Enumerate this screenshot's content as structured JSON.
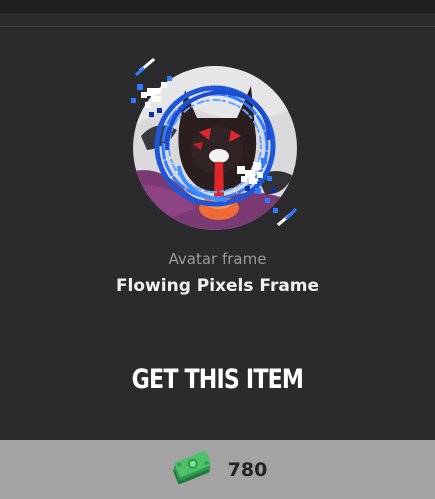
{
  "item": {
    "type_label": "Avatar frame",
    "name": "Flowing Pixels Frame"
  },
  "actions": {
    "get_item_label": "GET THIS ITEM"
  },
  "price": {
    "amount": "780",
    "currency_icon": "cash-stack-icon"
  },
  "colors": {
    "background": "#2b2b2e",
    "price_bar": "#a3a3a3",
    "frame_accent": "#2f7bff",
    "frame_highlight": "#ffffff"
  }
}
